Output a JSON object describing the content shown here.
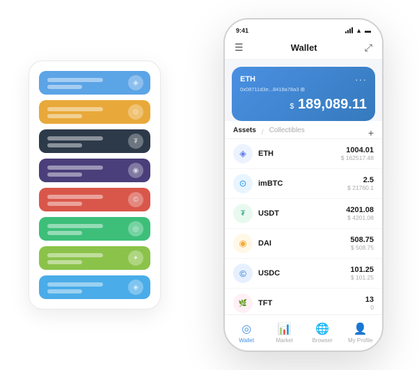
{
  "status_bar": {
    "time": "9:41",
    "signal": "···",
    "wifi": "wifi",
    "battery": "battery"
  },
  "header": {
    "menu_icon": "☰",
    "title": "Wallet",
    "expand_icon": "⤢"
  },
  "eth_card": {
    "label": "ETH",
    "dots": "···",
    "address": "0x08711d3e...8418a78a3  ⊞",
    "balance_symbol": "$",
    "balance": "189,089.11"
  },
  "assets_tabs": {
    "active": "Assets",
    "divider": "/",
    "inactive": "Collectibles",
    "add_label": "+"
  },
  "assets": [
    {
      "icon": "◈",
      "icon_color": "#627EEA",
      "bg_color": "#ECF3FF",
      "name": "ETH",
      "amount": "1004.01",
      "usd": "$ 162517.48"
    },
    {
      "icon": "⊙",
      "icon_color": "#2196F3",
      "bg_color": "#E8F5FF",
      "name": "imBTC",
      "amount": "2.5",
      "usd": "$ 21760.1"
    },
    {
      "icon": "₮",
      "icon_color": "#26A17B",
      "bg_color": "#E8FAF0",
      "name": "USDT",
      "amount": "4201.08",
      "usd": "$ 4201.08"
    },
    {
      "icon": "◉",
      "icon_color": "#F5AC37",
      "bg_color": "#FFF8E6",
      "name": "DAI",
      "amount": "508.75",
      "usd": "$ 508.75"
    },
    {
      "icon": "©",
      "icon_color": "#2775CA",
      "bg_color": "#E6F0FF",
      "name": "USDC",
      "amount": "101.25",
      "usd": "$ 101.25"
    },
    {
      "icon": "🌿",
      "icon_color": "#E83E8C",
      "bg_color": "#FFF0F5",
      "name": "TFT",
      "amount": "13",
      "usd": "0"
    }
  ],
  "nav": [
    {
      "icon": "◎",
      "label": "Wallet",
      "active": true
    },
    {
      "icon": "📈",
      "label": "Market",
      "active": false
    },
    {
      "icon": "🌐",
      "label": "Browser",
      "active": false
    },
    {
      "icon": "👤",
      "label": "My Profile",
      "active": false
    }
  ],
  "card_stack": {
    "colors": [
      "#5BA4E6",
      "#E8A93A",
      "#2D3A4A",
      "#4A3F7A",
      "#D9574A",
      "#3DBF7A",
      "#8BC34A",
      "#4AACE8"
    ]
  }
}
